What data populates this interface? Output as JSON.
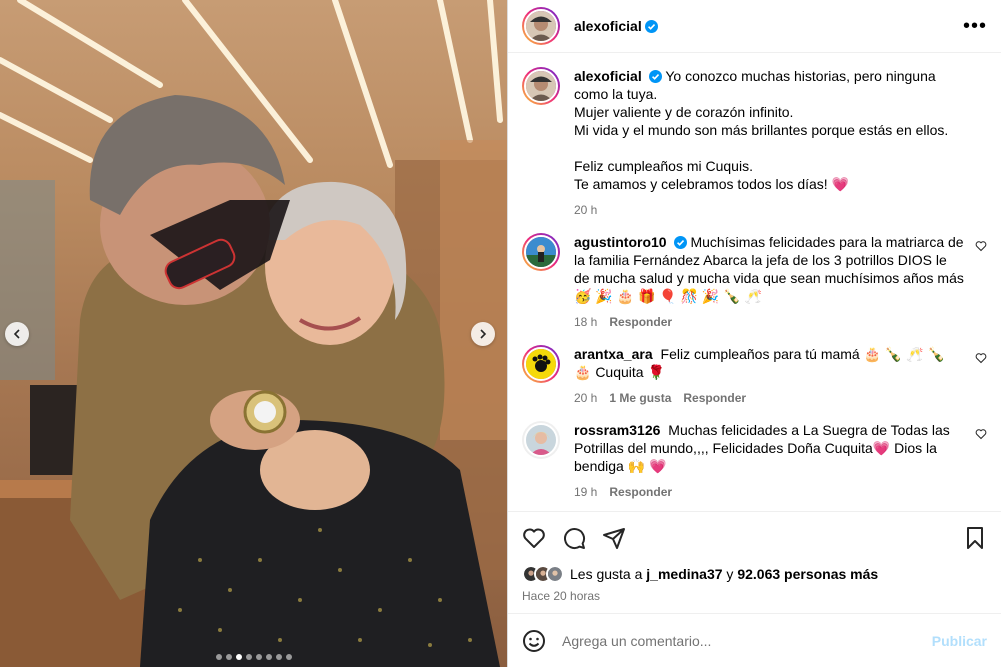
{
  "post": {
    "author": "alexoficial",
    "caption_lines": [
      "Yo conozco muchas historias, pero ninguna como la tuya.",
      "Mujer valiente y de corazón infinito.",
      "Mi vida y el mundo son más brillantes porque estás en ellos.",
      "",
      "Feliz cumpleaños mi Cuquis.",
      "Te amamos y celebramos todos los días! 💗"
    ],
    "caption_time": "20 h"
  },
  "comments": [
    {
      "user": "agustintoro10",
      "verified": true,
      "text": "Muchísimas felicidades para la matriarca de la familia Fernández Abarca la jefa de los 3 potrillos DIOS le de mucha salud y mucha vida que sean muchísimos años más 🥳 🎉 🎂 🎁 🎈 🎊 🎉 🍾 🥂",
      "time": "18 h",
      "likes": "",
      "reply": "Responder"
    },
    {
      "user": "arantxa_ara",
      "verified": false,
      "text": "Feliz cumpleaños para tú mamá 🎂 🍾 🥂 🍾 🎂 Cuquita 🌹",
      "time": "20 h",
      "likes": "1 Me gusta",
      "reply": "Responder"
    },
    {
      "user": "rossram3126",
      "verified": false,
      "text": "Muchas felicidades a La Suegra de Todas las Potrillas del mundo,,,, Felicidades Doña Cuquita💗  Dios la bendiga 🙌 💗",
      "time": "19 h",
      "likes": "",
      "reply": "Responder"
    }
  ],
  "likes": {
    "prefix": "Les gusta a ",
    "first_user": "j_medina37",
    "middle": " y ",
    "count_text": "92.063 personas más"
  },
  "posted_ago": "Hace 20 horas",
  "add_comment": {
    "placeholder": "Agrega un comentario...",
    "publish_label": "Publicar"
  },
  "carousel": {
    "total": 8,
    "active_index": 2
  },
  "colors": {
    "accent": "#0095f6",
    "publish_disabled": "#b2dffc",
    "heart": "#ff3040",
    "verified": "#0095f6"
  },
  "icons": [
    "more-options-icon",
    "heart-icon",
    "comment-icon",
    "share-icon",
    "bookmark-icon",
    "emoji-icon",
    "chevron-left-icon",
    "chevron-right-icon",
    "verified-badge-icon"
  ]
}
